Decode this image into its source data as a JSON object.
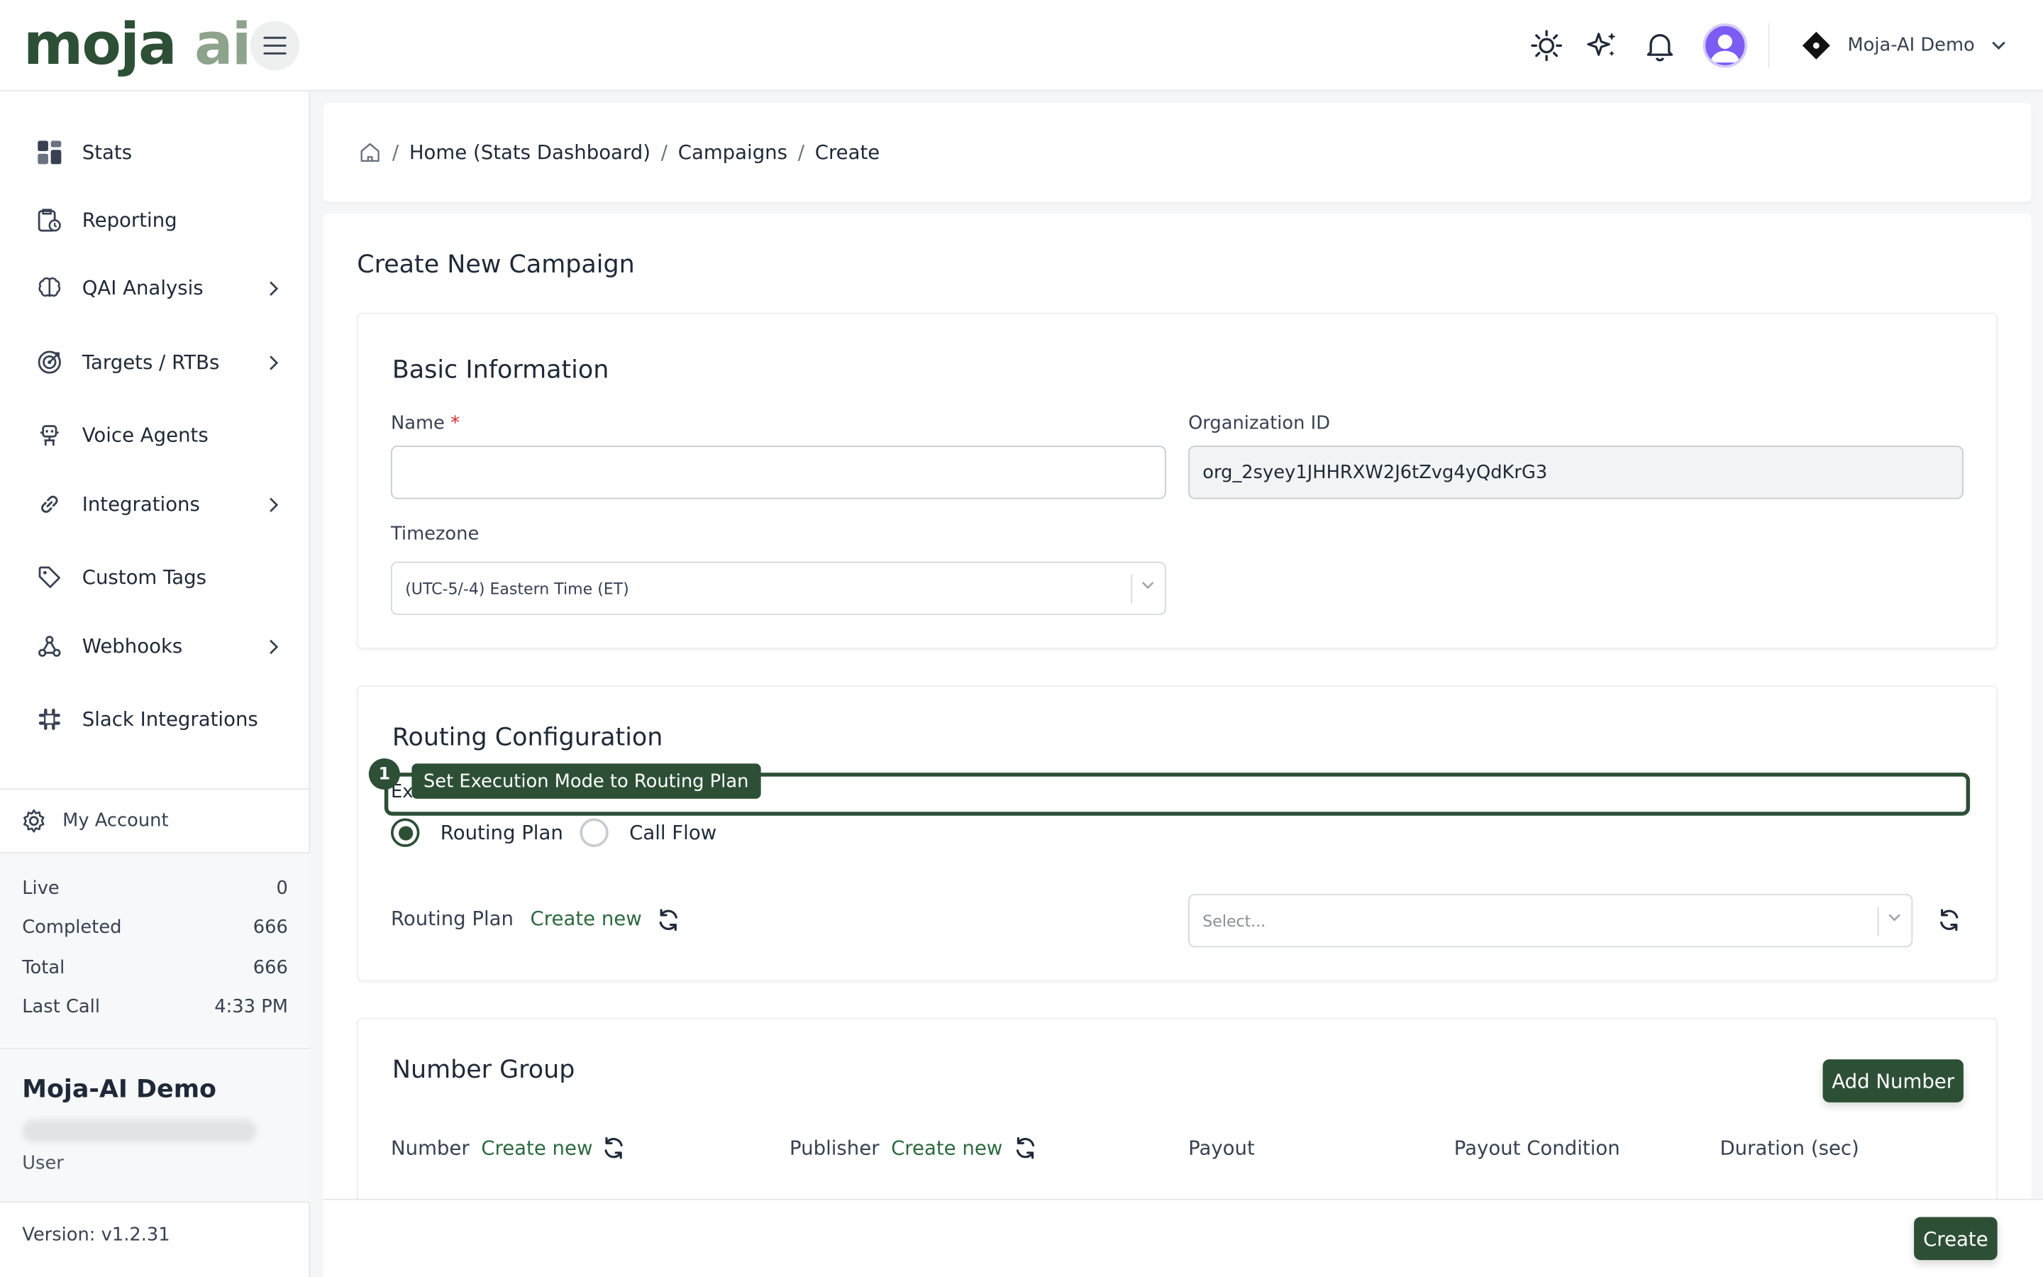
{
  "logo": {
    "part1": "moja",
    "part2": "ai"
  },
  "header": {
    "org_name": "Moja-AI Demo"
  },
  "sidebar": {
    "items": [
      {
        "label": "Stats",
        "icon": "dashboard-grid-icon"
      },
      {
        "label": "Reporting",
        "icon": "report-clock-icon"
      },
      {
        "label": "QAI Analysis",
        "icon": "brain-icon",
        "has_children": true
      },
      {
        "label": "Targets / RTBs",
        "icon": "target-icon",
        "has_children": true
      },
      {
        "label": "Voice Agents",
        "icon": "robot-icon"
      },
      {
        "label": "Integrations",
        "icon": "link-icon",
        "has_children": true
      },
      {
        "label": "Custom Tags",
        "icon": "tag-icon"
      },
      {
        "label": "Webhooks",
        "icon": "webhook-icon",
        "has_children": true
      },
      {
        "label": "Slack Integrations",
        "icon": "slack-icon"
      }
    ],
    "account_label": "My Account",
    "stats": [
      {
        "label": "Live",
        "value": "0"
      },
      {
        "label": "Completed",
        "value": "666"
      },
      {
        "label": "Total",
        "value": "666"
      },
      {
        "label": "Last Call",
        "value": "4:33 PM"
      }
    ],
    "user": {
      "name": "Moja-AI Demo",
      "role": "User"
    },
    "version": "Version: v1.2.31"
  },
  "breadcrumb": [
    "Home (Stats Dashboard)",
    "Campaigns",
    "Create"
  ],
  "page": {
    "title": "Create New Campaign"
  },
  "basic_info": {
    "title": "Basic Information",
    "name_label": "Name",
    "name_value": "",
    "required_mark": "*",
    "org_label": "Organization ID",
    "org_value": "org_2syey1JHHRXW2J6tZvg4yQdKrG3",
    "timezone_label": "Timezone",
    "timezone_value": "(UTC-5/-4) Eastern Time (ET)"
  },
  "routing": {
    "title": "Routing Configuration",
    "exec_label_partial": "Ex",
    "options": [
      "Routing Plan",
      "Call Flow"
    ],
    "selected": "Routing Plan",
    "plan_label": "Routing Plan",
    "create_new": "Create new",
    "select_placeholder": "Select..."
  },
  "tutorial": {
    "step": "1",
    "text": "Set Execution Mode to Routing Plan"
  },
  "number_group": {
    "title": "Number Group",
    "add_button": "Add Number",
    "columns": {
      "number": "Number",
      "publisher": "Publisher",
      "payout": "Payout",
      "payout_condition": "Payout Condition",
      "duration": "Duration (sec)"
    },
    "create_new": "Create new"
  },
  "footer": {
    "create_button": "Create"
  },
  "colors": {
    "brand": "#2d4f36",
    "brand_light": "#8ea38c",
    "avatar": "#7c5cf2"
  }
}
